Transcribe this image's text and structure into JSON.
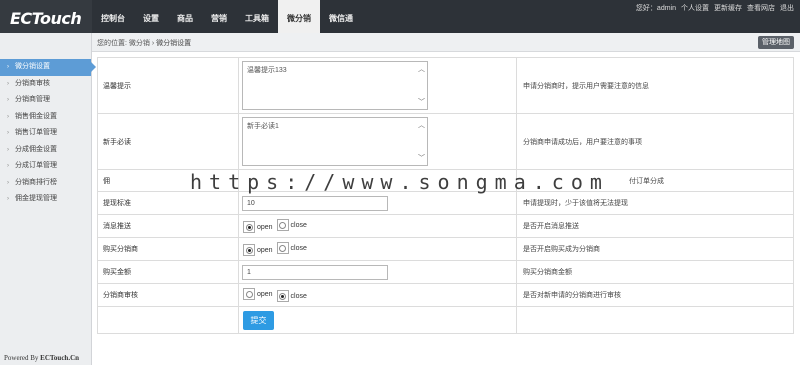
{
  "header": {
    "logo": "ECTouch",
    "nav": [
      "控制台",
      "设置",
      "商品",
      "营销",
      "工具箱",
      "微分销",
      "微信通"
    ],
    "active_nav": "微分销",
    "top_links": [
      "您好：admin",
      "个人设置",
      "更新缓存",
      "查看网店",
      "退出"
    ]
  },
  "breadcrumb": {
    "prefix": "您的位置:",
    "section": "微分销",
    "separator": "›",
    "current": "微分销设置"
  },
  "sitemap_button": "管理地图",
  "sidebar": {
    "items": [
      "微分销设置",
      "分销商审核",
      "分销商管理",
      "销售佣金设置",
      "销售订单管理",
      "分成佣金设置",
      "分成订单管理",
      "分销商排行榜",
      "佣金提现管理"
    ],
    "active": "微分销设置",
    "powered_by_prefix": "Powered By ",
    "powered_by_brand": "ECTouch.Cn"
  },
  "form": {
    "rows": [
      {
        "label": "温馨提示",
        "value": "温馨提示133",
        "note": "申请分销商时，提示用户需要注意的信息"
      },
      {
        "label": "新手必读",
        "value": "新手必读1",
        "note": "分销商申请成功后，用户要注意的事项"
      },
      {
        "label": "佣",
        "note": "付订单分成"
      },
      {
        "label": "提现标准",
        "value": "10",
        "note": "申请提现时，少于该值将无法提现"
      },
      {
        "label": "消息推送",
        "option_open": "open",
        "option_close": "close",
        "selected": "open",
        "note": "是否开启消息推送"
      },
      {
        "label": "购买分销商",
        "option_open": "open",
        "option_close": "close",
        "selected": "open",
        "note": "是否开启购买成为分销商"
      },
      {
        "label": "购买金额",
        "value": "1",
        "note": "购买分销商金额"
      },
      {
        "label": "分销商审核",
        "option_open": "open",
        "option_close": "close",
        "selected": "close",
        "note": "是否对新申请的分销商进行审核"
      }
    ],
    "submit_label": "提交"
  },
  "watermark": "https://www.songma.com"
}
